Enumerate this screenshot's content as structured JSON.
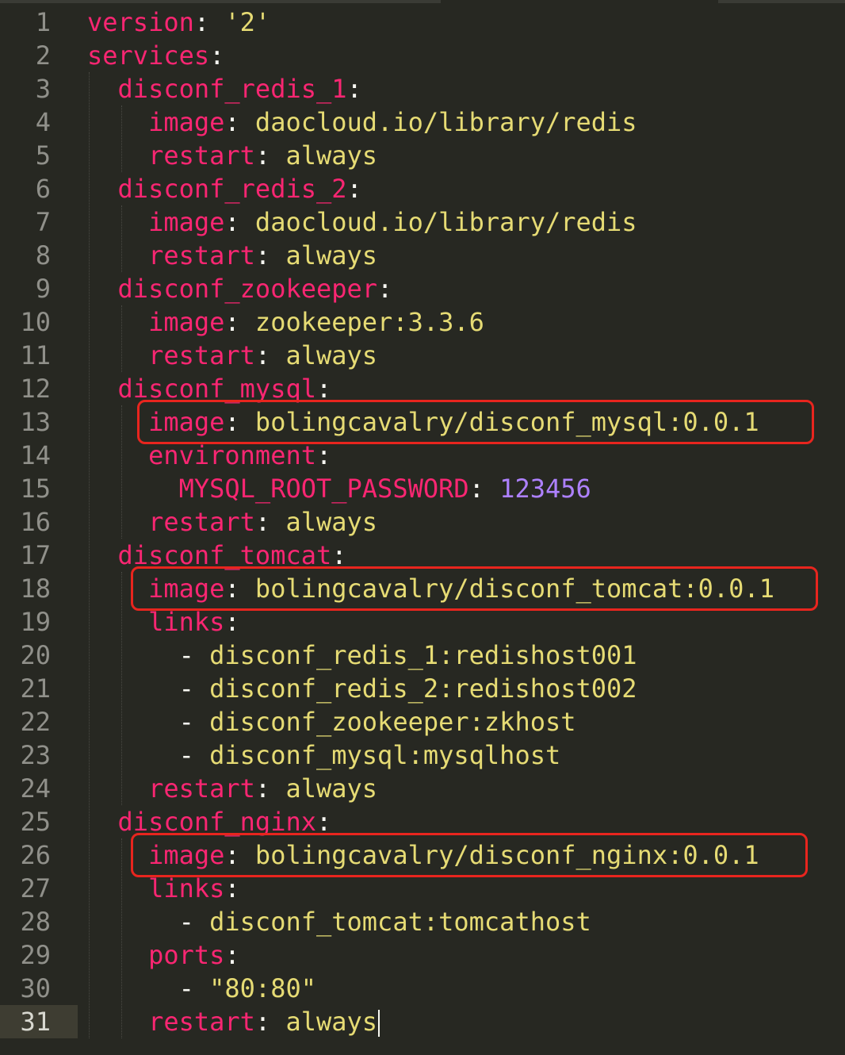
{
  "editor": {
    "current_line": 31,
    "colors": {
      "background": "#272822",
      "key": "#f92672",
      "string": "#e6db74",
      "number": "#ae81ff",
      "plain": "#f8f8f2",
      "highlight_box": "#e8251e"
    },
    "lines": [
      {
        "n": "1",
        "indent": 0,
        "segs": [
          {
            "t": "version",
            "c": "k"
          },
          {
            "t": ": ",
            "c": "p"
          },
          {
            "t": "'2'",
            "c": "s"
          }
        ]
      },
      {
        "n": "2",
        "indent": 0,
        "segs": [
          {
            "t": "services",
            "c": "k"
          },
          {
            "t": ":",
            "c": "p"
          }
        ]
      },
      {
        "n": "3",
        "indent": 1,
        "segs": [
          {
            "t": "disconf_redis_1",
            "c": "k"
          },
          {
            "t": ":",
            "c": "p"
          }
        ]
      },
      {
        "n": "4",
        "indent": 2,
        "segs": [
          {
            "t": "image",
            "c": "k"
          },
          {
            "t": ": ",
            "c": "p"
          },
          {
            "t": "daocloud.io/library/redis",
            "c": "s"
          }
        ]
      },
      {
        "n": "5",
        "indent": 2,
        "segs": [
          {
            "t": "restart",
            "c": "k"
          },
          {
            "t": ": ",
            "c": "p"
          },
          {
            "t": "always",
            "c": "s"
          }
        ]
      },
      {
        "n": "6",
        "indent": 1,
        "segs": [
          {
            "t": "disconf_redis_2",
            "c": "k"
          },
          {
            "t": ":",
            "c": "p"
          }
        ]
      },
      {
        "n": "7",
        "indent": 2,
        "segs": [
          {
            "t": "image",
            "c": "k"
          },
          {
            "t": ": ",
            "c": "p"
          },
          {
            "t": "daocloud.io/library/redis",
            "c": "s"
          }
        ]
      },
      {
        "n": "8",
        "indent": 2,
        "segs": [
          {
            "t": "restart",
            "c": "k"
          },
          {
            "t": ": ",
            "c": "p"
          },
          {
            "t": "always",
            "c": "s"
          }
        ]
      },
      {
        "n": "9",
        "indent": 1,
        "segs": [
          {
            "t": "disconf_zookeeper",
            "c": "k"
          },
          {
            "t": ":",
            "c": "p"
          }
        ]
      },
      {
        "n": "10",
        "indent": 2,
        "segs": [
          {
            "t": "image",
            "c": "k"
          },
          {
            "t": ": ",
            "c": "p"
          },
          {
            "t": "zookeeper:3.3.6",
            "c": "s"
          }
        ]
      },
      {
        "n": "11",
        "indent": 2,
        "segs": [
          {
            "t": "restart",
            "c": "k"
          },
          {
            "t": ": ",
            "c": "p"
          },
          {
            "t": "always",
            "c": "s"
          }
        ]
      },
      {
        "n": "12",
        "indent": 1,
        "segs": [
          {
            "t": "disconf_mysql",
            "c": "k"
          },
          {
            "t": ":",
            "c": "p"
          }
        ]
      },
      {
        "n": "13",
        "indent": 2,
        "segs": [
          {
            "t": "image",
            "c": "k"
          },
          {
            "t": ": ",
            "c": "p"
          },
          {
            "t": "bolingcavalry/disconf_mysql:0.0.1",
            "c": "s"
          }
        ]
      },
      {
        "n": "14",
        "indent": 2,
        "segs": [
          {
            "t": "environment",
            "c": "k"
          },
          {
            "t": ":",
            "c": "p"
          }
        ]
      },
      {
        "n": "15",
        "indent": 3,
        "segs": [
          {
            "t": "MYSQL_ROOT_PASSWORD",
            "c": "k"
          },
          {
            "t": ": ",
            "c": "p"
          },
          {
            "t": "123456",
            "c": "n"
          }
        ]
      },
      {
        "n": "16",
        "indent": 2,
        "segs": [
          {
            "t": "restart",
            "c": "k"
          },
          {
            "t": ": ",
            "c": "p"
          },
          {
            "t": "always",
            "c": "s"
          }
        ]
      },
      {
        "n": "17",
        "indent": 1,
        "segs": [
          {
            "t": "disconf_tomcat",
            "c": "k"
          },
          {
            "t": ":",
            "c": "p"
          }
        ]
      },
      {
        "n": "18",
        "indent": 2,
        "segs": [
          {
            "t": "image",
            "c": "k"
          },
          {
            "t": ": ",
            "c": "p"
          },
          {
            "t": "bolingcavalry/disconf_tomcat:0.0.1",
            "c": "s"
          }
        ]
      },
      {
        "n": "19",
        "indent": 2,
        "segs": [
          {
            "t": "links",
            "c": "k"
          },
          {
            "t": ":",
            "c": "p"
          }
        ]
      },
      {
        "n": "20",
        "indent": 3,
        "segs": [
          {
            "t": "- ",
            "c": "p"
          },
          {
            "t": "disconf_redis_1:redishost001",
            "c": "s"
          }
        ]
      },
      {
        "n": "21",
        "indent": 3,
        "segs": [
          {
            "t": "- ",
            "c": "p"
          },
          {
            "t": "disconf_redis_2:redishost002",
            "c": "s"
          }
        ]
      },
      {
        "n": "22",
        "indent": 3,
        "segs": [
          {
            "t": "- ",
            "c": "p"
          },
          {
            "t": "disconf_zookeeper:zkhost",
            "c": "s"
          }
        ]
      },
      {
        "n": "23",
        "indent": 3,
        "segs": [
          {
            "t": "- ",
            "c": "p"
          },
          {
            "t": "disconf_mysql:mysqlhost",
            "c": "s"
          }
        ]
      },
      {
        "n": "24",
        "indent": 2,
        "segs": [
          {
            "t": "restart",
            "c": "k"
          },
          {
            "t": ": ",
            "c": "p"
          },
          {
            "t": "always",
            "c": "s"
          }
        ]
      },
      {
        "n": "25",
        "indent": 1,
        "segs": [
          {
            "t": "disconf_nginx",
            "c": "k"
          },
          {
            "t": ":",
            "c": "p"
          }
        ]
      },
      {
        "n": "26",
        "indent": 2,
        "segs": [
          {
            "t": "image",
            "c": "k"
          },
          {
            "t": ": ",
            "c": "p"
          },
          {
            "t": "bolingcavalry/disconf_nginx:0.0.1",
            "c": "s"
          }
        ]
      },
      {
        "n": "27",
        "indent": 2,
        "segs": [
          {
            "t": "links",
            "c": "k"
          },
          {
            "t": ":",
            "c": "p"
          }
        ]
      },
      {
        "n": "28",
        "indent": 3,
        "segs": [
          {
            "t": "- ",
            "c": "p"
          },
          {
            "t": "disconf_tomcat:tomcathost",
            "c": "s"
          }
        ]
      },
      {
        "n": "29",
        "indent": 2,
        "segs": [
          {
            "t": "ports",
            "c": "k"
          },
          {
            "t": ":",
            "c": "p"
          }
        ]
      },
      {
        "n": "30",
        "indent": 3,
        "segs": [
          {
            "t": "- ",
            "c": "p"
          },
          {
            "t": "\"80:80\"",
            "c": "s"
          }
        ]
      },
      {
        "n": "31",
        "indent": 2,
        "segs": [
          {
            "t": "restart",
            "c": "k"
          },
          {
            "t": ": ",
            "c": "p"
          },
          {
            "t": "always",
            "c": "s"
          }
        ]
      }
    ],
    "highlighted_lines": [
      13,
      18,
      26
    ]
  }
}
